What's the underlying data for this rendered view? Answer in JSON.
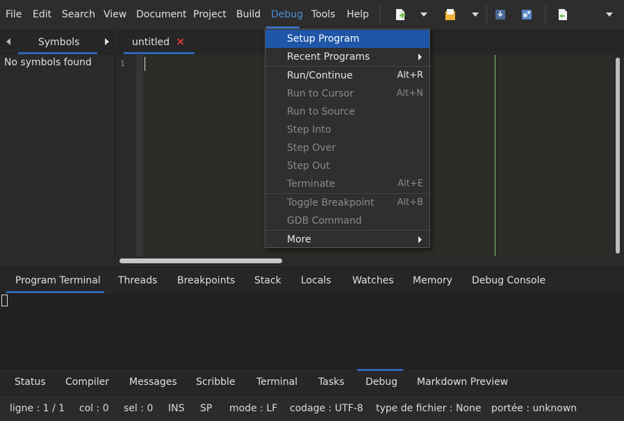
{
  "menubar": {
    "items": [
      {
        "label": "File"
      },
      {
        "label": "Edit"
      },
      {
        "label": "Search"
      },
      {
        "label": "View"
      },
      {
        "label": "Document"
      },
      {
        "label": "Project"
      },
      {
        "label": "Build"
      },
      {
        "label": "Debug"
      },
      {
        "label": "Tools"
      },
      {
        "label": "Help"
      }
    ]
  },
  "toolbar": {
    "icons": [
      "new-file-icon",
      "open-file-icon",
      "step-icon",
      "debug-icon",
      "save-icon"
    ],
    "colors": {
      "new": "#6fbf3f",
      "open": "#e8a52a",
      "debug": "#5b86c7",
      "save": "#74b84a"
    }
  },
  "sidebar": {
    "tab": "Symbols",
    "message": "No symbols found"
  },
  "editor": {
    "tab": "untitled",
    "close_glyph": "×",
    "close_color": "#e03b3b",
    "line_number": "1"
  },
  "debug_menu": {
    "items": [
      {
        "label": "Setup Program",
        "shortcut": "",
        "state": "selected"
      },
      {
        "label": "Recent Programs",
        "shortcut": "",
        "state": "enabled",
        "submenu": true
      },
      {
        "label": "Run/Continue",
        "shortcut": "Alt+R",
        "state": "enabled"
      },
      {
        "label": "Run to Cursor",
        "shortcut": "Alt+N",
        "state": "disabled"
      },
      {
        "label": "Run to Source",
        "shortcut": "",
        "state": "disabled"
      },
      {
        "label": "Step Into",
        "shortcut": "",
        "state": "disabled"
      },
      {
        "label": "Step Over",
        "shortcut": "",
        "state": "disabled"
      },
      {
        "label": "Step Out",
        "shortcut": "",
        "state": "disabled"
      },
      {
        "label": "Terminate",
        "shortcut": "Alt+E",
        "state": "disabled"
      },
      {
        "label": "Toggle Breakpoint",
        "shortcut": "Alt+B",
        "state": "disabled"
      },
      {
        "label": "GDB Command",
        "shortcut": "",
        "state": "disabled"
      },
      {
        "label": "More",
        "shortcut": "",
        "state": "enabled",
        "submenu": true
      }
    ]
  },
  "debug_panel": {
    "tabs": [
      {
        "label": "Program Terminal"
      },
      {
        "label": "Threads"
      },
      {
        "label": "Breakpoints"
      },
      {
        "label": "Stack"
      },
      {
        "label": "Locals"
      },
      {
        "label": "Watches"
      },
      {
        "label": "Memory"
      },
      {
        "label": "Debug Console"
      }
    ]
  },
  "message_tabs": {
    "tabs": [
      {
        "label": "Status"
      },
      {
        "label": "Compiler"
      },
      {
        "label": "Messages"
      },
      {
        "label": "Scribble"
      },
      {
        "label": "Terminal"
      },
      {
        "label": "Tasks"
      },
      {
        "label": "Debug"
      },
      {
        "label": "Markdown Preview"
      }
    ]
  },
  "statusbar": {
    "line": "ligne : 1 / 1",
    "col": "col : 0",
    "sel": "sel : 0",
    "ins": "INS",
    "sp": "SP",
    "mode": "mode : LF",
    "encoding": "codage : UTF-8",
    "filetype": "type de fichier : None",
    "scope": "portée : unknown"
  },
  "accent_color": "#2f67b4"
}
